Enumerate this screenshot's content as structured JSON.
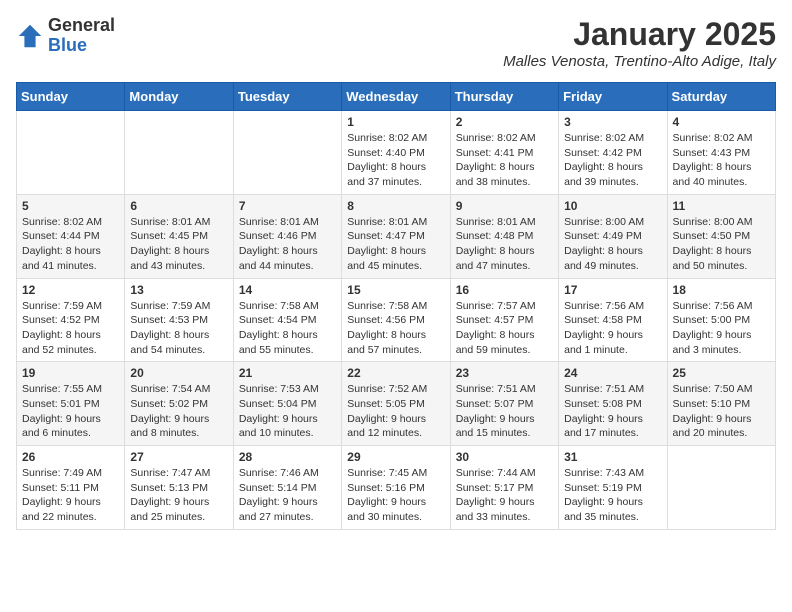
{
  "header": {
    "logo_general": "General",
    "logo_blue": "Blue",
    "month_title": "January 2025",
    "location": "Malles Venosta, Trentino-Alto Adige, Italy"
  },
  "weekdays": [
    "Sunday",
    "Monday",
    "Tuesday",
    "Wednesday",
    "Thursday",
    "Friday",
    "Saturday"
  ],
  "weeks": [
    [
      {
        "day": "",
        "info": ""
      },
      {
        "day": "",
        "info": ""
      },
      {
        "day": "",
        "info": ""
      },
      {
        "day": "1",
        "info": "Sunrise: 8:02 AM\nSunset: 4:40 PM\nDaylight: 8 hours and 37 minutes."
      },
      {
        "day": "2",
        "info": "Sunrise: 8:02 AM\nSunset: 4:41 PM\nDaylight: 8 hours and 38 minutes."
      },
      {
        "day": "3",
        "info": "Sunrise: 8:02 AM\nSunset: 4:42 PM\nDaylight: 8 hours and 39 minutes."
      },
      {
        "day": "4",
        "info": "Sunrise: 8:02 AM\nSunset: 4:43 PM\nDaylight: 8 hours and 40 minutes."
      }
    ],
    [
      {
        "day": "5",
        "info": "Sunrise: 8:02 AM\nSunset: 4:44 PM\nDaylight: 8 hours and 41 minutes."
      },
      {
        "day": "6",
        "info": "Sunrise: 8:01 AM\nSunset: 4:45 PM\nDaylight: 8 hours and 43 minutes."
      },
      {
        "day": "7",
        "info": "Sunrise: 8:01 AM\nSunset: 4:46 PM\nDaylight: 8 hours and 44 minutes."
      },
      {
        "day": "8",
        "info": "Sunrise: 8:01 AM\nSunset: 4:47 PM\nDaylight: 8 hours and 45 minutes."
      },
      {
        "day": "9",
        "info": "Sunrise: 8:01 AM\nSunset: 4:48 PM\nDaylight: 8 hours and 47 minutes."
      },
      {
        "day": "10",
        "info": "Sunrise: 8:00 AM\nSunset: 4:49 PM\nDaylight: 8 hours and 49 minutes."
      },
      {
        "day": "11",
        "info": "Sunrise: 8:00 AM\nSunset: 4:50 PM\nDaylight: 8 hours and 50 minutes."
      }
    ],
    [
      {
        "day": "12",
        "info": "Sunrise: 7:59 AM\nSunset: 4:52 PM\nDaylight: 8 hours and 52 minutes."
      },
      {
        "day": "13",
        "info": "Sunrise: 7:59 AM\nSunset: 4:53 PM\nDaylight: 8 hours and 54 minutes."
      },
      {
        "day": "14",
        "info": "Sunrise: 7:58 AM\nSunset: 4:54 PM\nDaylight: 8 hours and 55 minutes."
      },
      {
        "day": "15",
        "info": "Sunrise: 7:58 AM\nSunset: 4:56 PM\nDaylight: 8 hours and 57 minutes."
      },
      {
        "day": "16",
        "info": "Sunrise: 7:57 AM\nSunset: 4:57 PM\nDaylight: 8 hours and 59 minutes."
      },
      {
        "day": "17",
        "info": "Sunrise: 7:56 AM\nSunset: 4:58 PM\nDaylight: 9 hours and 1 minute."
      },
      {
        "day": "18",
        "info": "Sunrise: 7:56 AM\nSunset: 5:00 PM\nDaylight: 9 hours and 3 minutes."
      }
    ],
    [
      {
        "day": "19",
        "info": "Sunrise: 7:55 AM\nSunset: 5:01 PM\nDaylight: 9 hours and 6 minutes."
      },
      {
        "day": "20",
        "info": "Sunrise: 7:54 AM\nSunset: 5:02 PM\nDaylight: 9 hours and 8 minutes."
      },
      {
        "day": "21",
        "info": "Sunrise: 7:53 AM\nSunset: 5:04 PM\nDaylight: 9 hours and 10 minutes."
      },
      {
        "day": "22",
        "info": "Sunrise: 7:52 AM\nSunset: 5:05 PM\nDaylight: 9 hours and 12 minutes."
      },
      {
        "day": "23",
        "info": "Sunrise: 7:51 AM\nSunset: 5:07 PM\nDaylight: 9 hours and 15 minutes."
      },
      {
        "day": "24",
        "info": "Sunrise: 7:51 AM\nSunset: 5:08 PM\nDaylight: 9 hours and 17 minutes."
      },
      {
        "day": "25",
        "info": "Sunrise: 7:50 AM\nSunset: 5:10 PM\nDaylight: 9 hours and 20 minutes."
      }
    ],
    [
      {
        "day": "26",
        "info": "Sunrise: 7:49 AM\nSunset: 5:11 PM\nDaylight: 9 hours and 22 minutes."
      },
      {
        "day": "27",
        "info": "Sunrise: 7:47 AM\nSunset: 5:13 PM\nDaylight: 9 hours and 25 minutes."
      },
      {
        "day": "28",
        "info": "Sunrise: 7:46 AM\nSunset: 5:14 PM\nDaylight: 9 hours and 27 minutes."
      },
      {
        "day": "29",
        "info": "Sunrise: 7:45 AM\nSunset: 5:16 PM\nDaylight: 9 hours and 30 minutes."
      },
      {
        "day": "30",
        "info": "Sunrise: 7:44 AM\nSunset: 5:17 PM\nDaylight: 9 hours and 33 minutes."
      },
      {
        "day": "31",
        "info": "Sunrise: 7:43 AM\nSunset: 5:19 PM\nDaylight: 9 hours and 35 minutes."
      },
      {
        "day": "",
        "info": ""
      }
    ]
  ]
}
